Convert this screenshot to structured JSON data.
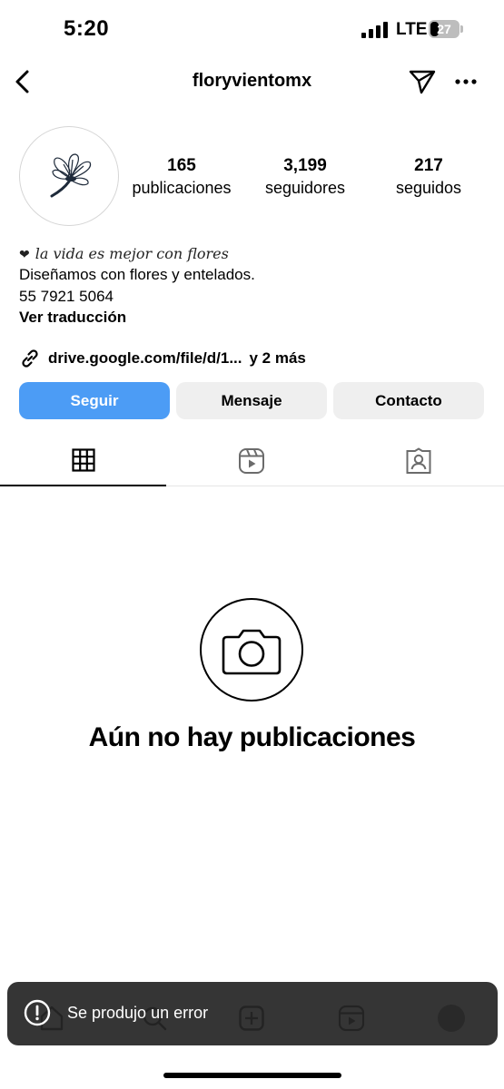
{
  "status_bar": {
    "time": "5:20",
    "network": "LTE",
    "battery": "27"
  },
  "header": {
    "username": "floryvientomx",
    "back_icon": "chevron-left-icon",
    "send_icon": "paper-plane-icon",
    "more_icon": "ellipsis-icon"
  },
  "profile": {
    "stats": [
      {
        "value": "165",
        "label": "publicaciones"
      },
      {
        "value": "3,199",
        "label": "seguidores"
      },
      {
        "value": "217",
        "label": "seguidos"
      }
    ],
    "bio": {
      "motto": "la vida es mejor con flores",
      "line1": "Diseñamos con flores y entelados.",
      "phone": "55 7921 5064",
      "translate": "Ver traducción"
    },
    "link": {
      "url": "drive.google.com/file/d/1...",
      "more": "y 2 más"
    }
  },
  "actions": {
    "follow": "Seguir",
    "message": "Mensaje",
    "contact": "Contacto"
  },
  "tabs": [
    "grid-icon",
    "reels-icon",
    "tagged-icon"
  ],
  "empty_state": {
    "title": "Aún no hay publicaciones",
    "icon": "camera-icon"
  },
  "toast": {
    "message": "Se produjo un error",
    "icon": "alert-circle-icon"
  },
  "colors": {
    "accent": "#4c9cf5",
    "secondary_button": "#efefef",
    "toast_bg": "#262626"
  }
}
